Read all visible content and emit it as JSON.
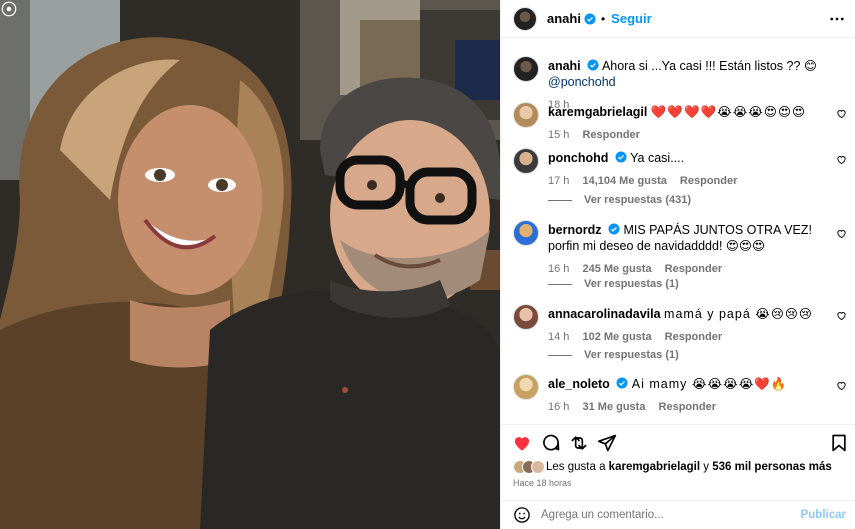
{
  "post": {
    "username": "anahi",
    "follow_label": "Seguir",
    "dot": "•"
  },
  "caption": {
    "username": "anahi",
    "text": "Ahora si ...Ya casi !!! Están listos ?? 😊",
    "mention": "@ponchohd",
    "time": "18 h"
  },
  "comments": [
    {
      "username": "karemgabrielagil",
      "text": "❤️❤️❤️❤️😭😭😭😍😍😍",
      "time": "15 h",
      "likes": "",
      "reply": "Responder",
      "verified": false
    },
    {
      "username": "ponchohd",
      "text": "Ya casi....",
      "time": "17 h",
      "likes": "14,104 Me gusta",
      "reply": "Responder",
      "view_replies": "Ver respuestas (431)",
      "verified": true
    },
    {
      "username": "bernordz",
      "text": "MIS PAPÁS JUNTOS OTRA VEZ! porfin mi deseo de navidadddd! 😍😍😍",
      "time": "16 h",
      "likes": "245 Me gusta",
      "reply": "Responder",
      "view_replies": "Ver respuestas (1)",
      "verified": true
    },
    {
      "username": "annacarolinadavila",
      "text": "mamá y papá 😭😢😢😢",
      "time": "14 h",
      "likes": "102 Me gusta",
      "reply": "Responder",
      "view_replies": "Ver respuestas (1)",
      "verified": false
    },
    {
      "username": "ale_noleto",
      "text": "Ai mamy 😭😭😭😭❤️🔥",
      "time": "16 h",
      "likes": "31 Me gusta",
      "reply": "Responder",
      "verified": true
    }
  ],
  "likes": {
    "prefix": "Les gusta a",
    "user": "karemgabrielagil",
    "middle": "y",
    "count": "536 mil personas más"
  },
  "posted_ago": "Hace 18 horas",
  "composer": {
    "placeholder": "Agrega un comentario...",
    "publish": "Publicar"
  },
  "colors": {
    "accent": "#0095f6",
    "like_red": "#ff3040",
    "muted": "#737373"
  },
  "icons": [
    "verified-badge-icon",
    "more-options-icon",
    "heart-icon",
    "comment-icon",
    "share-icon",
    "send-icon",
    "bookmark-icon",
    "emoji-icon",
    "carousel-icon"
  ]
}
